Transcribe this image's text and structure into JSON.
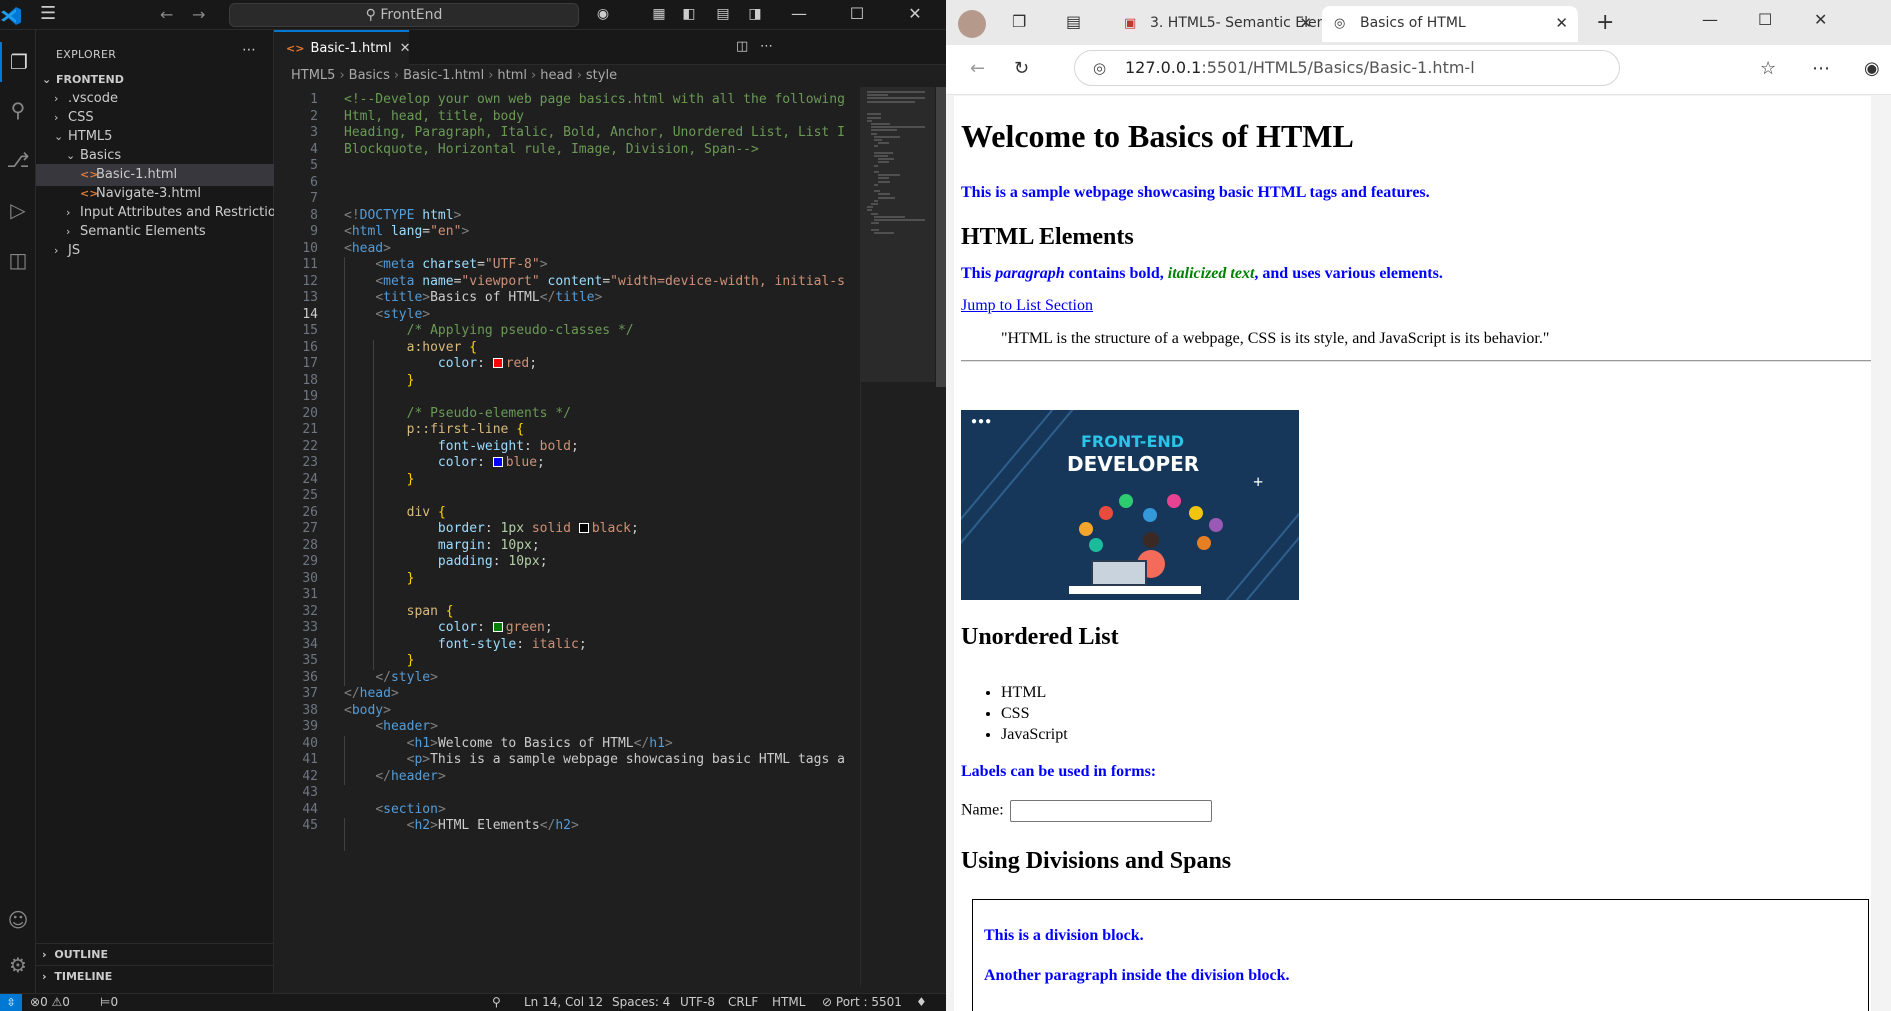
{
  "vscode": {
    "search_text": "FrontEnd",
    "explorer_title": "EXPLORER",
    "tree": [
      {
        "label": "FRONTEND",
        "depth": 0,
        "chevron": "v",
        "type": "root"
      },
      {
        "label": ".vscode",
        "depth": 1,
        "chevron": ">",
        "type": "folder"
      },
      {
        "label": "CSS",
        "depth": 1,
        "chevron": ">",
        "type": "folder"
      },
      {
        "label": "HTML5",
        "depth": 1,
        "chevron": "v",
        "type": "folder"
      },
      {
        "label": "Basics",
        "depth": 2,
        "chevron": "v",
        "type": "folder"
      },
      {
        "label": "Basic-1.html",
        "depth": 3,
        "chevron": "",
        "type": "file",
        "selected": true
      },
      {
        "label": "Navigate-3.html",
        "depth": 3,
        "chevron": "",
        "type": "file"
      },
      {
        "label": "Input Attributes and Restrictions",
        "depth": 2,
        "chevron": ">",
        "type": "folder"
      },
      {
        "label": "Semantic Elements",
        "depth": 2,
        "chevron": ">",
        "type": "folder"
      },
      {
        "label": "JS",
        "depth": 1,
        "chevron": ">",
        "type": "folder"
      }
    ],
    "outline_label": "OUTLINE",
    "timeline_label": "TIMELINE",
    "tab_label": "Basic-1.html",
    "breadcrumb": [
      "HTML5",
      "Basics",
      "Basic-1.html",
      "html",
      "head",
      "style"
    ],
    "current_line": 14,
    "code_lines": [
      [
        [
          "c-com",
          "<!--Develop your own web page basics.html with all the following"
        ]
      ],
      [
        [
          "c-com",
          "Html, head, title, body"
        ]
      ],
      [
        [
          "c-com",
          "Heading, Paragraph, Italic, Bold, Anchor, Unordered List, List I"
        ]
      ],
      [
        [
          "c-com",
          "Blockquote, Horizontal rule, Image, Division, Span-->"
        ]
      ],
      [],
      [],
      [],
      [
        [
          "c-punct",
          "<!"
        ],
        [
          "c-tag",
          "DOCTYPE"
        ],
        [
          "c-text",
          " "
        ],
        [
          "c-attr",
          "html"
        ],
        [
          "c-punct",
          ">"
        ]
      ],
      [
        [
          "c-punct",
          "<"
        ],
        [
          "c-tag",
          "html"
        ],
        [
          "c-text",
          " "
        ],
        [
          "c-attr",
          "lang"
        ],
        [
          "c-text",
          "="
        ],
        [
          "c-str",
          "\"en\""
        ],
        [
          "c-punct",
          ">"
        ]
      ],
      [
        [
          "c-punct",
          "<"
        ],
        [
          "c-tag",
          "head"
        ],
        [
          "c-punct",
          ">"
        ]
      ],
      [
        [
          "c-text",
          "    "
        ],
        [
          "c-punct",
          "<"
        ],
        [
          "c-tag",
          "meta"
        ],
        [
          "c-text",
          " "
        ],
        [
          "c-attr",
          "charset"
        ],
        [
          "c-text",
          "="
        ],
        [
          "c-str",
          "\"UTF-8\""
        ],
        [
          "c-punct",
          ">"
        ]
      ],
      [
        [
          "c-text",
          "    "
        ],
        [
          "c-punct",
          "<"
        ],
        [
          "c-tag",
          "meta"
        ],
        [
          "c-text",
          " "
        ],
        [
          "c-attr",
          "name"
        ],
        [
          "c-text",
          "="
        ],
        [
          "c-str",
          "\"viewport\""
        ],
        [
          "c-text",
          " "
        ],
        [
          "c-attr",
          "content"
        ],
        [
          "c-text",
          "="
        ],
        [
          "c-str",
          "\"width=device-width, initial-s"
        ]
      ],
      [
        [
          "c-text",
          "    "
        ],
        [
          "c-punct",
          "<"
        ],
        [
          "c-tag",
          "title"
        ],
        [
          "c-punct",
          ">"
        ],
        [
          "c-text",
          "Basics of HTML"
        ],
        [
          "c-punct",
          "</"
        ],
        [
          "c-tag",
          "title"
        ],
        [
          "c-punct",
          ">"
        ]
      ],
      [
        [
          "c-text",
          "    "
        ],
        [
          "c-punct",
          "<"
        ],
        [
          "c-tag",
          "style"
        ],
        [
          "c-punct",
          ">"
        ]
      ],
      [
        [
          "c-text",
          "        "
        ],
        [
          "c-com",
          "/* Applying pseudo-classes */"
        ]
      ],
      [
        [
          "c-text",
          "        "
        ],
        [
          "c-sel",
          "a:hover"
        ],
        [
          "c-text",
          " "
        ],
        [
          "c-brace",
          "{"
        ]
      ],
      [
        [
          "c-text",
          "            "
        ],
        [
          "c-attr",
          "color"
        ],
        [
          "c-text",
          ": "
        ],
        [
          "swatch:#ff0000",
          ""
        ],
        [
          "c-str",
          "red"
        ],
        [
          "c-text",
          ";"
        ]
      ],
      [
        [
          "c-text",
          "        "
        ],
        [
          "c-brace",
          "}"
        ]
      ],
      [],
      [
        [
          "c-text",
          "        "
        ],
        [
          "c-com",
          "/* Pseudo-elements */"
        ]
      ],
      [
        [
          "c-text",
          "        "
        ],
        [
          "c-sel",
          "p::first-line"
        ],
        [
          "c-text",
          " "
        ],
        [
          "c-brace",
          "{"
        ]
      ],
      [
        [
          "c-text",
          "            "
        ],
        [
          "c-attr",
          "font-weight"
        ],
        [
          "c-text",
          ": "
        ],
        [
          "c-str",
          "bold"
        ],
        [
          "c-text",
          ";"
        ]
      ],
      [
        [
          "c-text",
          "            "
        ],
        [
          "c-attr",
          "color"
        ],
        [
          "c-text",
          ": "
        ],
        [
          "swatch:#0000ff",
          ""
        ],
        [
          "c-str",
          "blue"
        ],
        [
          "c-text",
          ";"
        ]
      ],
      [
        [
          "c-text",
          "        "
        ],
        [
          "c-brace",
          "}"
        ]
      ],
      [],
      [
        [
          "c-text",
          "        "
        ],
        [
          "c-sel",
          "div"
        ],
        [
          "c-text",
          " "
        ],
        [
          "c-brace",
          "{"
        ]
      ],
      [
        [
          "c-text",
          "            "
        ],
        [
          "c-attr",
          "border"
        ],
        [
          "c-text",
          ": "
        ],
        [
          "c-num",
          "1px"
        ],
        [
          "c-text",
          " "
        ],
        [
          "c-str",
          "solid"
        ],
        [
          "c-text",
          " "
        ],
        [
          "swatch:#000000",
          ""
        ],
        [
          "c-str",
          "black"
        ],
        [
          "c-text",
          ";"
        ]
      ],
      [
        [
          "c-text",
          "            "
        ],
        [
          "c-attr",
          "margin"
        ],
        [
          "c-text",
          ": "
        ],
        [
          "c-num",
          "10px"
        ],
        [
          "c-text",
          ";"
        ]
      ],
      [
        [
          "c-text",
          "            "
        ],
        [
          "c-attr",
          "padding"
        ],
        [
          "c-text",
          ": "
        ],
        [
          "c-num",
          "10px"
        ],
        [
          "c-text",
          ";"
        ]
      ],
      [
        [
          "c-text",
          "        "
        ],
        [
          "c-brace",
          "}"
        ]
      ],
      [],
      [
        [
          "c-text",
          "        "
        ],
        [
          "c-sel",
          "span"
        ],
        [
          "c-text",
          " "
        ],
        [
          "c-brace",
          "{"
        ]
      ],
      [
        [
          "c-text",
          "            "
        ],
        [
          "c-attr",
          "color"
        ],
        [
          "c-text",
          ": "
        ],
        [
          "swatch:#008000",
          ""
        ],
        [
          "c-str",
          "green"
        ],
        [
          "c-text",
          ";"
        ]
      ],
      [
        [
          "c-text",
          "            "
        ],
        [
          "c-attr",
          "font-style"
        ],
        [
          "c-text",
          ": "
        ],
        [
          "c-str",
          "italic"
        ],
        [
          "c-text",
          ";"
        ]
      ],
      [
        [
          "c-text",
          "        "
        ],
        [
          "c-brace",
          "}"
        ]
      ],
      [
        [
          "c-text",
          "    "
        ],
        [
          "c-punct",
          "</"
        ],
        [
          "c-tag",
          "style"
        ],
        [
          "c-punct",
          ">"
        ]
      ],
      [
        [
          "c-punct",
          "</"
        ],
        [
          "c-tag",
          "head"
        ],
        [
          "c-punct",
          ">"
        ]
      ],
      [
        [
          "c-punct",
          "<"
        ],
        [
          "c-tag",
          "body"
        ],
        [
          "c-punct",
          ">"
        ]
      ],
      [
        [
          "c-text",
          "    "
        ],
        [
          "c-punct",
          "<"
        ],
        [
          "c-tag",
          "header"
        ],
        [
          "c-punct",
          ">"
        ]
      ],
      [
        [
          "c-text",
          "        "
        ],
        [
          "c-punct",
          "<"
        ],
        [
          "c-tag",
          "h1"
        ],
        [
          "c-punct",
          ">"
        ],
        [
          "c-text",
          "Welcome to Basics of HTML"
        ],
        [
          "c-punct",
          "</"
        ],
        [
          "c-tag",
          "h1"
        ],
        [
          "c-punct",
          ">"
        ]
      ],
      [
        [
          "c-text",
          "        "
        ],
        [
          "c-punct",
          "<"
        ],
        [
          "c-tag",
          "p"
        ],
        [
          "c-punct",
          ">"
        ],
        [
          "c-text",
          "This is a sample webpage showcasing basic HTML tags a"
        ]
      ],
      [
        [
          "c-text",
          "    "
        ],
        [
          "c-punct",
          "</"
        ],
        [
          "c-tag",
          "header"
        ],
        [
          "c-punct",
          ">"
        ]
      ],
      [],
      [
        [
          "c-text",
          "    "
        ],
        [
          "c-punct",
          "<"
        ],
        [
          "c-tag",
          "section"
        ],
        [
          "c-punct",
          ">"
        ]
      ],
      [
        [
          "c-text",
          "        "
        ],
        [
          "c-punct",
          "<"
        ],
        [
          "c-tag",
          "h2"
        ],
        [
          "c-punct",
          ">"
        ],
        [
          "c-text",
          "HTML Elements"
        ],
        [
          "c-punct",
          "</"
        ],
        [
          "c-tag",
          "h2"
        ],
        [
          "c-punct",
          ">"
        ]
      ]
    ],
    "status": {
      "errors": "0",
      "warnings": "0",
      "ports": "0",
      "position": "Ln 14, Col 12",
      "spaces": "Spaces: 4",
      "encoding": "UTF-8",
      "eol": "CRLF",
      "language": "HTML",
      "port": "Port : 5501"
    }
  },
  "browser": {
    "tabs": [
      {
        "title": "3. HTML5- Semantic Elemen",
        "active": false
      },
      {
        "title": "Basics of HTML",
        "active": true
      }
    ],
    "url_host": "127.0.0.1",
    "url_rest": ":5501/HTML5/Basics/Basic-1.htm-l",
    "page": {
      "h1": "Welcome to Basics of HTML",
      "intro": "This is a sample webpage showcasing basic HTML tags and features.",
      "h2_elements": "HTML Elements",
      "para_parts": [
        "This ",
        "paragraph",
        " contains bold, ",
        "italicized text",
        ", and uses various elements."
      ],
      "link": "Jump to List Section",
      "quote": "\"HTML is the structure of a webpage, CSS is its style, and JavaScript is its behavior.\"",
      "image_line1": "FRONT-END",
      "image_line2": "DEVELOPER",
      "h2_list": "Unordered List",
      "list_items": [
        "HTML",
        "CSS",
        "JavaScript"
      ],
      "labels_text": "Labels can be used in forms:",
      "name_label": "Name:",
      "name_value": "",
      "h2_divs": "Using Divisions and Spans",
      "div_p1": "This is a division block.",
      "div_p2": "Another paragraph inside the division block."
    }
  },
  "colors": {
    "vs_accent": "#0078d4",
    "link": "#0000ee",
    "first_line_blue": "#0000ff",
    "span_green": "#008000"
  }
}
